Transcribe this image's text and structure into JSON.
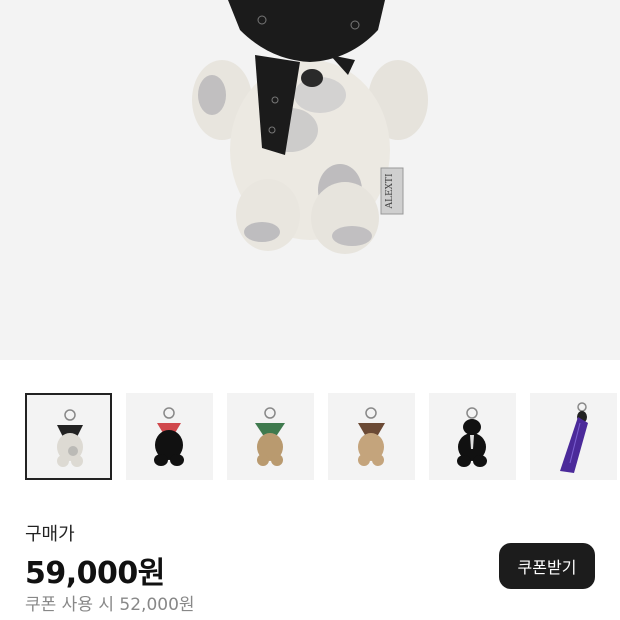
{
  "product": {
    "image_icon": "bear-keyring-with-bandana",
    "tag_text": "ALEXTI"
  },
  "thumbnails": [
    {
      "icon": "bear-black-bandana-icon",
      "selected": true
    },
    {
      "icon": "bear-red-bandana-icon",
      "selected": false
    },
    {
      "icon": "bear-green-bandana-icon",
      "selected": false
    },
    {
      "icon": "bear-brown-bandana-icon",
      "selected": false
    },
    {
      "icon": "bear-black-tie-icon",
      "selected": false
    },
    {
      "icon": "purple-scarf-icon",
      "selected": false
    }
  ],
  "pricing": {
    "label": "구매가",
    "price": "59,000원",
    "coupon_price": "쿠폰 사용 시 52,000원",
    "coupon_button": "쿠폰받기"
  },
  "colors": {
    "hero_bg": "#f3f3f3",
    "button_bg": "#1c1c1c",
    "muted_text": "#888888"
  }
}
